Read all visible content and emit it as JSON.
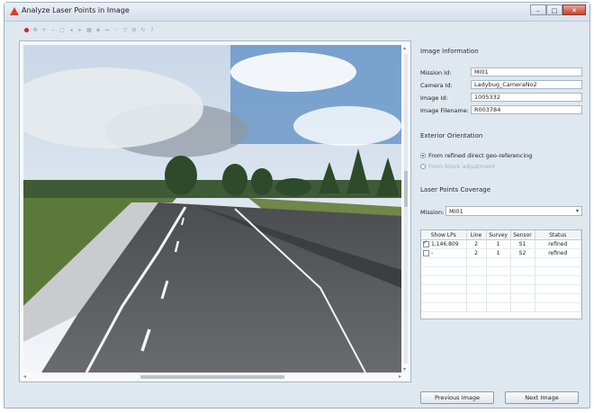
{
  "window": {
    "title": "Analyze Laser Points in Image",
    "controls": {
      "minimize": "–",
      "maximize": "□",
      "close": "✕"
    }
  },
  "toolbar": {
    "icons": [
      "record-icon",
      "pan-icon",
      "zoom-in-icon",
      "zoom-out-icon",
      "fit-icon",
      "prev-icon",
      "next-icon",
      "grid-icon",
      "layers-icon",
      "measure-icon",
      "points-icon",
      "filter-icon",
      "settings-icon",
      "rotate-icon",
      "help-icon"
    ]
  },
  "image_info": {
    "heading": "Image Information",
    "fields": [
      {
        "label": "Mission Id:",
        "value": "MI01"
      },
      {
        "label": "Camera Id:",
        "value": "Ladybug_CameraNo2"
      },
      {
        "label": "Image Id:",
        "value": "1005332"
      },
      {
        "label": "Image Filename:",
        "value": "R003784"
      }
    ]
  },
  "exterior": {
    "heading": "Exterior Orientation",
    "options": [
      {
        "label": "From refined direct geo-referencing",
        "selected": true,
        "enabled": true
      },
      {
        "label": "From block adjustment",
        "selected": false,
        "enabled": false
      }
    ]
  },
  "coverage": {
    "heading": "Laser Points Coverage",
    "mission_label": "Mission:",
    "mission_value": "MI01",
    "columns": [
      "Show LPs",
      "Line",
      "Survey",
      "Sensor",
      "Status"
    ],
    "rows": [
      {
        "checked": true,
        "show": "1,146,809",
        "line": "2",
        "survey": "1",
        "sensor": "S1",
        "status": "refined"
      },
      {
        "checked": false,
        "show": "-",
        "line": "2",
        "survey": "1",
        "sensor": "S2",
        "status": "refined"
      }
    ]
  },
  "buttons": {
    "previous": "Previous Image",
    "next": "Next Image"
  },
  "colors": {
    "accent": "#1e5fa8",
    "record": "#d32222"
  }
}
